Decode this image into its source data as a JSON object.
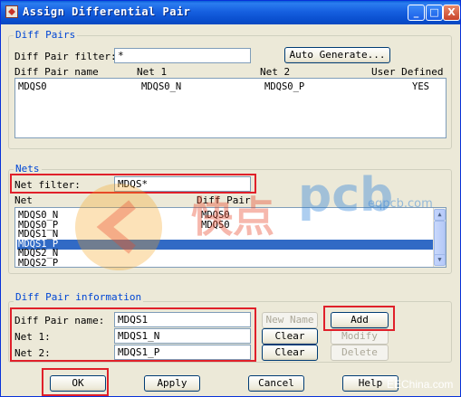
{
  "window": {
    "title": "Assign Differential Pair"
  },
  "title_buttons": {
    "minimize": "_",
    "maximize": "□",
    "close": "X"
  },
  "diff_pairs": {
    "group_label": "Diff Pairs",
    "filter_label": "Diff Pair filter:",
    "filter_value": "*",
    "auto_generate_label": "Auto Generate...",
    "columns": {
      "name": "Diff Pair name",
      "net1": "Net 1",
      "net2": "Net 2",
      "user_defined": "User Defined"
    },
    "rows": [
      {
        "name": "MDQS0",
        "net1": "MDQS0_N",
        "net2": "MDQS0_P",
        "user_defined": "YES"
      }
    ]
  },
  "nets": {
    "group_label": "Nets",
    "filter_label": "Net filter:",
    "filter_value": "MDQS*",
    "columns": {
      "net": "Net",
      "diff_pair": "Diff Pair"
    },
    "rows": [
      {
        "net": "MDQS0_N",
        "diff_pair": "MDQS0",
        "selected": false
      },
      {
        "net": "MDQS0_P",
        "diff_pair": "MDQS0",
        "selected": false
      },
      {
        "net": "MDQS1_N",
        "diff_pair": "",
        "selected": false
      },
      {
        "net": "MDQS1_P",
        "diff_pair": "",
        "selected": true
      },
      {
        "net": "MDQS2_N",
        "diff_pair": "",
        "selected": false
      },
      {
        "net": "MDQS2_P",
        "diff_pair": "",
        "selected": false
      }
    ]
  },
  "diff_pair_info": {
    "group_label": "Diff Pair information",
    "name_label": "Diff Pair name:",
    "name_value": "MDQS1",
    "net1_label": "Net 1:",
    "net1_value": "MDQS1_N",
    "net2_label": "Net 2:",
    "net2_value": "MDQS1_P",
    "new_name_label": "New Name",
    "add_label": "Add",
    "clear1_label": "Clear",
    "modify_label": "Modify",
    "clear2_label": "Clear",
    "delete_label": "Delete"
  },
  "footer": {
    "ok_label": "OK",
    "apply_label": "Apply",
    "cancel_label": "Cancel",
    "help_label": "Help"
  },
  "watermark": {
    "brand": "快点",
    "logo": "pcb",
    "url": "eqpcb.com"
  },
  "credit": "EEChina.com",
  "colors": {
    "title_bar": "#0a4fcf",
    "group_label": "#0046d5",
    "selection": "#316ac5",
    "highlight_box": "#e0202a",
    "dialog_bg": "#ece9d8"
  }
}
